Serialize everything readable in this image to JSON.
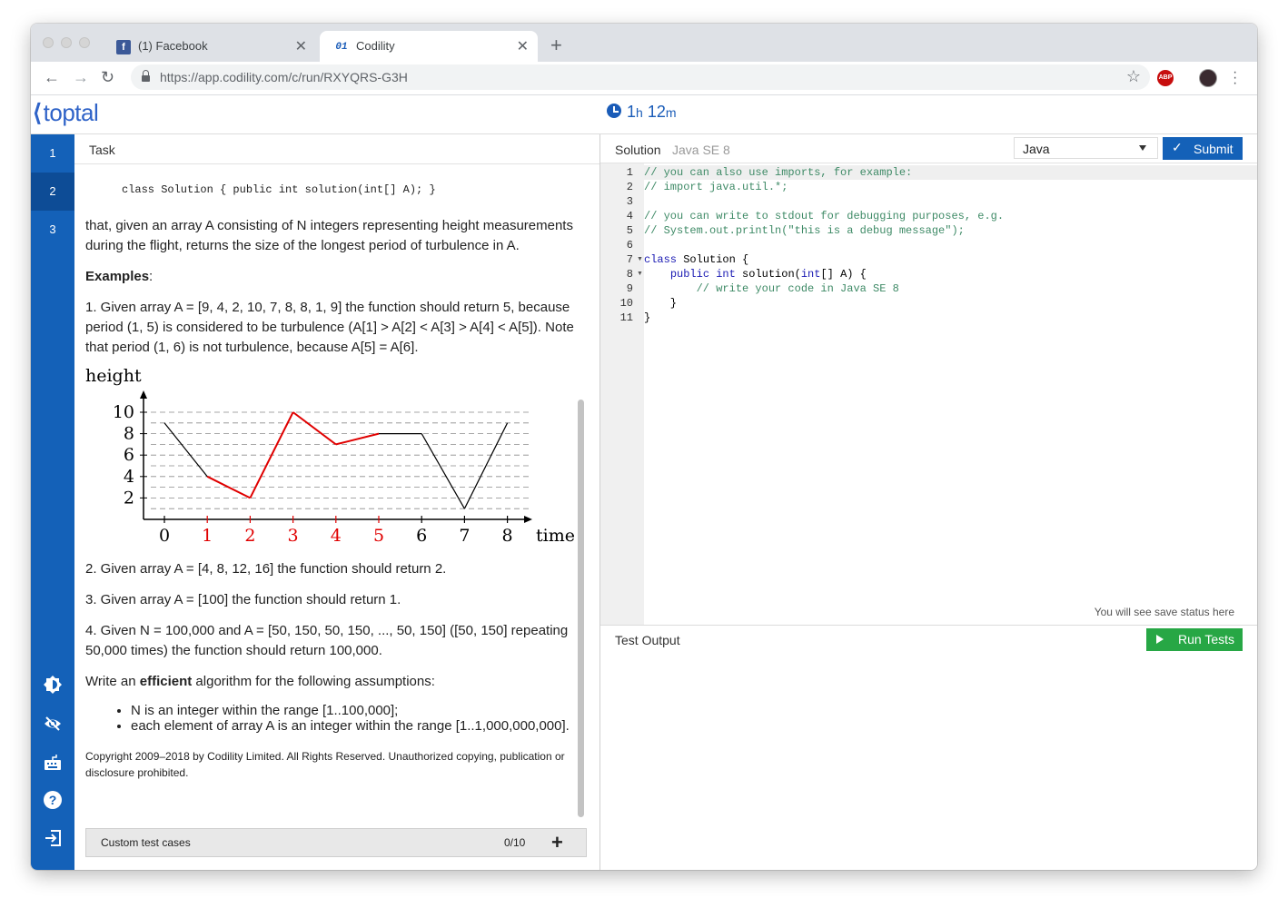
{
  "browser": {
    "tabs": [
      {
        "title": "(1) Facebook",
        "icon": "facebook-icon"
      },
      {
        "title": "Codility",
        "icon": "codility-icon"
      }
    ],
    "url_host": "https://app.codility.com",
    "url_path": "/c/run/RXYQRS-G3H",
    "abp_label": "ABP",
    "fb_glyph": "f",
    "cod_glyph": "01"
  },
  "header": {
    "logo_text": "toptal",
    "timer_hours": "1",
    "timer_h": "h",
    "timer_minutes": "12",
    "timer_m": "m",
    "brand_color": "#1461b8"
  },
  "sidebar": {
    "tasks": [
      "1",
      "2",
      "3"
    ],
    "active": "2",
    "tools": [
      "brightness-icon",
      "eye-icon",
      "keyboard-icon",
      "help-icon",
      "logout-icon"
    ]
  },
  "task": {
    "header": "Task",
    "signature": "class Solution { public int solution(int[] A); }",
    "intro": "that, given an array A consisting of N integers representing height measurements during the flight, returns the size of the longest period of turbulence in A.",
    "examples_label": "Examples",
    "examples_colon": ":",
    "example1": "1. Given array A = [9, 4, 2, 10, 7, 8, 8, 1, 9] the function should return 5, because period (1, 5) is considered to be turbulence (A[1] > A[2] < A[3] > A[4] < A[5]). Note that period (1, 6) is not turbulence, because A[5] = A[6].",
    "example2": "2. Given array A = [4, 8, 12, 16] the function should return 2.",
    "example3": "3. Given array A = [100] the function should return 1.",
    "example4": "4. Given N = 100,000 and A = [50, 150, 50, 150, ..., 50, 150] ([50, 150] repeating 50,000 times) the function should return 100,000.",
    "write_pre": "Write an ",
    "write_bold": "efficient",
    "write_post": " algorithm for the following assumptions:",
    "assumptions": [
      "N is an integer within the range [1..100,000];",
      "each element of array A is an integer within the range [1..1,000,000,000]."
    ],
    "copyright": "Copyright 2009–2018 by Codility Limited. All Rights Reserved. Unauthorized copying, publication or disclosure prohibited.",
    "custom_tests_label": "Custom test cases",
    "custom_tests_count": "0/10",
    "add_symbol": "+"
  },
  "chart_data": {
    "type": "line",
    "xlabel": "time",
    "ylabel": "height",
    "x": [
      0,
      1,
      2,
      3,
      4,
      5,
      6,
      7,
      8
    ],
    "values": [
      9,
      4,
      2,
      10,
      7,
      8,
      8,
      1,
      9
    ],
    "yticks": [
      2,
      4,
      6,
      8,
      10
    ],
    "highlight_range": [
      1,
      5
    ],
    "colors": {
      "normal": "#000000",
      "highlight": "#e00000"
    },
    "grid": "dashed horizontal"
  },
  "solution": {
    "header": "Solution",
    "version": "Java SE 8",
    "language": "Java",
    "submit_label": "Submit",
    "code_lines": [
      "// you can also use imports, for example:",
      "// import java.util.*;",
      "",
      "// you can write to stdout for debugging purposes, e.g.",
      "// System.out.println(\"this is a debug message\");",
      "",
      "class Solution {",
      "    public int solution(int[] A) {",
      "        // write your code in Java SE 8",
      "    }",
      "}"
    ],
    "save_status": "You will see save status here"
  },
  "test_output": {
    "header": "Test Output",
    "run_label": "Run Tests"
  }
}
